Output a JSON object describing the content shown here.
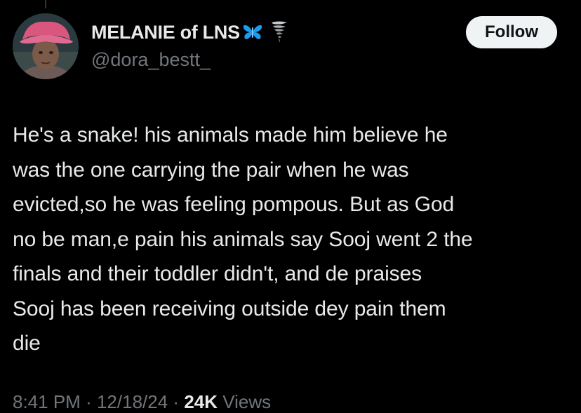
{
  "tweet": {
    "author": {
      "display_name": "MELANIE of LNS",
      "handle": "@dora_bestt_",
      "badges": [
        "butterfly-icon",
        "tornado-icon"
      ]
    },
    "follow_label": "Follow",
    "text": "He's a snake! his animals made him believe he\nwas the one carrying the pair when he was\nevicted,so he was feeling pompous. But as God\nno be man,e pain his animals say Sooj went 2 the\nfinals and their toddler didn't, and de praises\nSooj has been receiving outside dey pain them\ndie",
    "time": "8:41 PM",
    "separator": "·",
    "date": "12/18/24",
    "views_count": "24K",
    "views_label": "Views"
  },
  "colors": {
    "background": "#000000",
    "text_primary": "#e7e9ea",
    "text_secondary": "#71767b",
    "follow_bg": "#eff3f4",
    "follow_text": "#0f1419",
    "butterfly": "#1d9bf0"
  }
}
